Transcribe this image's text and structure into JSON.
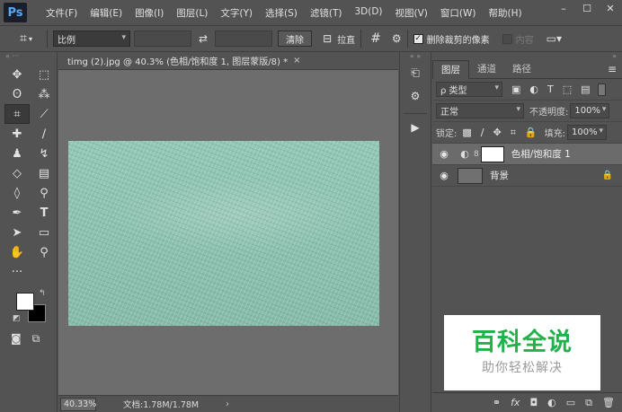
{
  "app": {
    "logo": "Ps"
  },
  "menu": [
    "文件(F)",
    "编辑(E)",
    "图像(I)",
    "图层(L)",
    "文字(Y)",
    "选择(S)",
    "滤镜(T)",
    "3D(D)",
    "视图(V)",
    "窗口(W)",
    "帮助(H)"
  ],
  "window_controls": {
    "minimize": "–",
    "maximize": "☐",
    "close": "✕"
  },
  "options": {
    "ratio": "比例",
    "swap_icon": "⇄",
    "clear": "清除",
    "straighten": "拉直",
    "delete_cropped_label": "删除裁剪的像素",
    "delete_cropped_checked": true,
    "content_aware_label": "内容"
  },
  "document": {
    "tab_title": "timg (2).jpg @ 40.3% (色相/饱和度 1, 图层蒙版/8) *",
    "close": "×",
    "zoom": "40.33%",
    "doc_size": "文档:1.78M/1.78M",
    "status_arrow": "›"
  },
  "swatches": {
    "foreground": "#ffffff",
    "background": "#000000"
  },
  "layers_panel": {
    "tabs": [
      "图层",
      "通道",
      "路径"
    ],
    "filter_kind": "ρ 类型",
    "blend_mode": "正常",
    "opacity_label": "不透明度:",
    "opacity_value": "100%",
    "lock_label": "锁定:",
    "fill_label": "填充:",
    "fill_value": "100%",
    "layers": [
      {
        "name": "色相/饱和度 1",
        "selected": true,
        "visible": true
      },
      {
        "name": "背景",
        "selected": false,
        "visible": true,
        "locked": true
      }
    ]
  },
  "watermark": {
    "title": "百科全说",
    "subtitle": "助你轻松解决",
    "color": "#22b24c"
  },
  "colors": {
    "canvas_bg": "#6d6d6d",
    "ui_bg": "#535353",
    "image_tint": "#8fc4b2"
  }
}
